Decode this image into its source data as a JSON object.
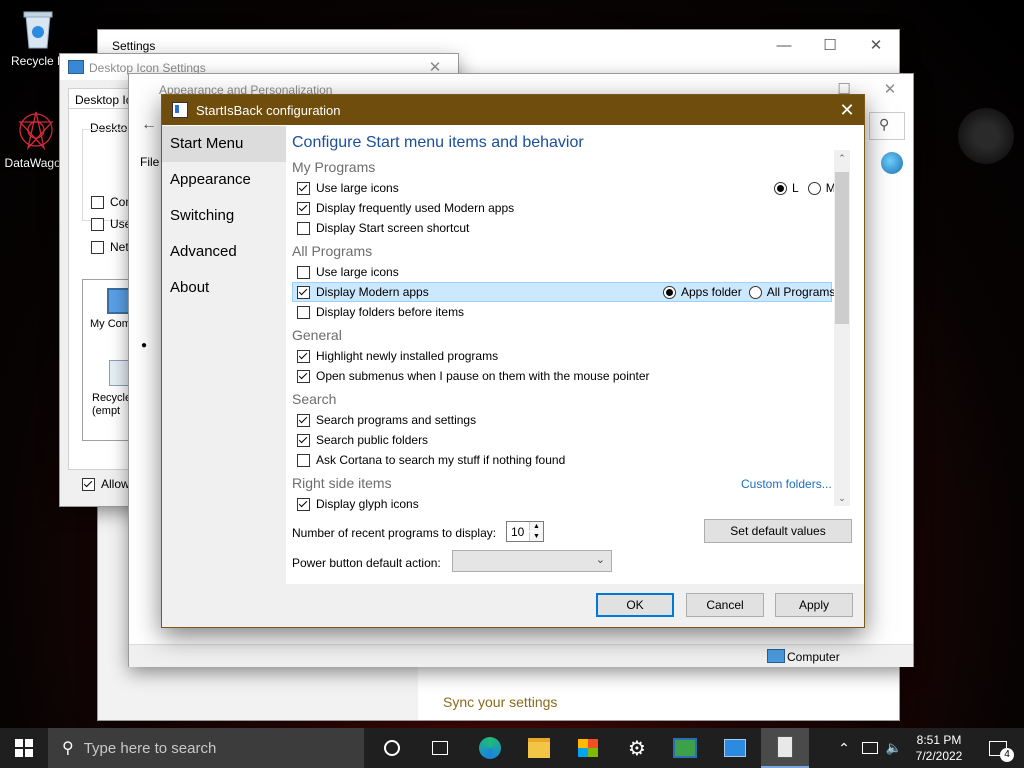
{
  "desktop": {
    "icons": [
      {
        "label": "Recycle B"
      },
      {
        "label": "DataWagon"
      }
    ]
  },
  "settings_window": {
    "title": "Settings",
    "sync_link": "Sync your settings"
  },
  "desktop_icon_window": {
    "title": "Desktop Icon Settings",
    "tab": "Desktop Ico",
    "group": "Desktop",
    "checks": [
      "Comp",
      "User",
      "Netw"
    ],
    "icons": [
      "My Comp",
      "Recycle (empt"
    ],
    "allow": "Allow t"
  },
  "appearance_window": {
    "title": "Appearance and Personalization",
    "file_menu": "File",
    "status": "Computer"
  },
  "sib": {
    "title": "StartIsBack configuration",
    "nav": [
      "Start Menu",
      "Appearance",
      "Switching",
      "Advanced",
      "About"
    ],
    "heading": "Configure Start menu items and behavior",
    "sections": {
      "my_programs": "My Programs",
      "all_programs": "All Programs",
      "general": "General",
      "search": "Search",
      "right_side": "Right side items"
    },
    "items": {
      "use_large_icons_mp": {
        "label": "Use large icons",
        "checked": true
      },
      "freq_modern": {
        "label": "Display frequently used Modern apps",
        "checked": true
      },
      "start_screen": {
        "label": "Display Start screen shortcut",
        "checked": false
      },
      "use_large_icons_ap": {
        "label": "Use large icons",
        "checked": false
      },
      "modern_apps": {
        "label": "Display Modern apps",
        "checked": true
      },
      "folders_before": {
        "label": "Display folders before items",
        "checked": false
      },
      "highlight_new": {
        "label": "Highlight newly installed programs",
        "checked": true
      },
      "open_submenus": {
        "label": "Open submenus when I pause on them with the mouse pointer",
        "checked": true
      },
      "search_programs": {
        "label": "Search programs and settings",
        "checked": true
      },
      "search_public": {
        "label": "Search public folders",
        "checked": true
      },
      "ask_cortana": {
        "label": "Ask Cortana to search my stuff if nothing found",
        "checked": false
      },
      "glyph_icons": {
        "label": "Display glyph icons",
        "checked": true
      }
    },
    "size_radio": {
      "l": "L",
      "m": "M",
      "selected": "L"
    },
    "apps_radio": {
      "apps_folder": "Apps folder",
      "all_programs": "All Programs",
      "selected": "Apps folder"
    },
    "custom_folders": "Custom folders...",
    "recent_label": "Number of recent programs to display:",
    "recent_value": "10",
    "set_default": "Set default values",
    "power_label": "Power button default action:",
    "power_value": "",
    "ok": "OK",
    "cancel": "Cancel",
    "apply": "Apply"
  },
  "taskbar": {
    "search_placeholder": "Type here to search",
    "time": "8:51 PM",
    "date": "7/2/2022",
    "notification_count": "4"
  },
  "colors": {
    "title_bar": "#6f4d0c",
    "heading": "#1b4f98",
    "link": "#1f6ec4",
    "highlight": "#cce8ff"
  }
}
